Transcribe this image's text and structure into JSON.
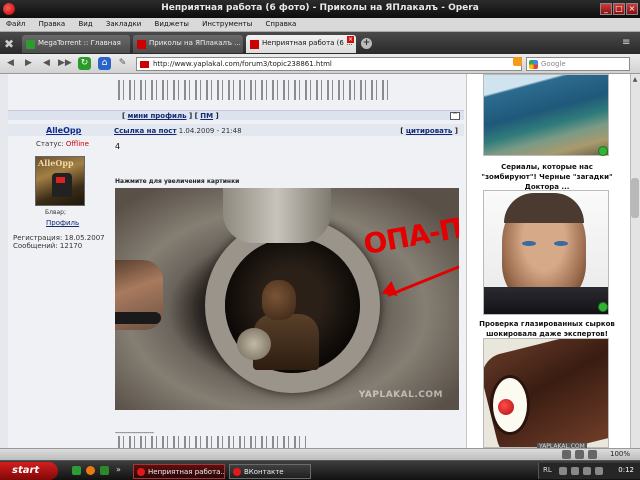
{
  "window": {
    "title": "Неприятная работа (6 фото) - Приколы на ЯПлакалъ - Opera",
    "controls": {
      "minimize": "_",
      "maximize": "□",
      "close": "×"
    }
  },
  "menu": [
    "Файл",
    "Правка",
    "Вид",
    "Закладки",
    "Виджеты",
    "Инструменты",
    "Справка"
  ],
  "tabs": [
    {
      "label": "MegaTorrent :: Главная",
      "active": false
    },
    {
      "label": "Приколы на ЯПлакалъ ...",
      "active": false
    },
    {
      "label": "Неприятная работа (6 ...",
      "active": true
    }
  ],
  "tab_icons": {
    "tools": "tools-icon",
    "new_tab": "+",
    "close": "×",
    "tab_menu": "≡"
  },
  "nav": {
    "address": "http://www.yaplakal.com/forum3/topic238861.html",
    "search_placeholder": "Google",
    "buttons": {
      "back": "◀",
      "forward": "▶",
      "fast_forward": "▶▶",
      "reload": "↻",
      "home": "⌂",
      "edit": "✎"
    }
  },
  "post": {
    "links": {
      "open": "[",
      "mini_profile": "мини профиль",
      "separator": "] [",
      "pm": "ПМ",
      "close": "]"
    },
    "collapse": "^",
    "author": "AlleOpp",
    "link_label": "Ссылка на пост",
    "date": "1.04.2009 - 21:48",
    "quote_label": "цитировать",
    "quote_open": "[",
    "quote_close": "]",
    "status_label": "Статус:",
    "status_value": "Offline",
    "avatar_text": "AlleOpp",
    "avatar_caption": "Блвар;",
    "profile_link": "Профиль",
    "registration": "Регистрация: 18.05.2007",
    "messages": "Сообщений: 12170",
    "text": "4",
    "enlarge_hint": "Нажмите для увеличения картинки",
    "photo_handwriting": "ОПА-ПА",
    "photo_watermark": "YAPLAKAL.COM",
    "bottom_dashes": "-------------------"
  },
  "sidebar": {
    "ad1_caption": "Сериалы, которые нас \"зомбируют\"! Черные \"загадки\" Доктора ...",
    "ad2_caption": "Проверка глазированных сырков шокировала даже экспертов!",
    "ad3_watermark": "YAPLAKAL.COM"
  },
  "statusbar": {
    "zoom": "100%"
  },
  "taskbar": {
    "start": "start",
    "tasks": [
      {
        "label": "Неприятная работа...",
        "active": true
      },
      {
        "label": "ВКонтакте",
        "active": false
      }
    ],
    "quicklaunch_more": "»",
    "lang": "RL",
    "clock": "0:12"
  }
}
